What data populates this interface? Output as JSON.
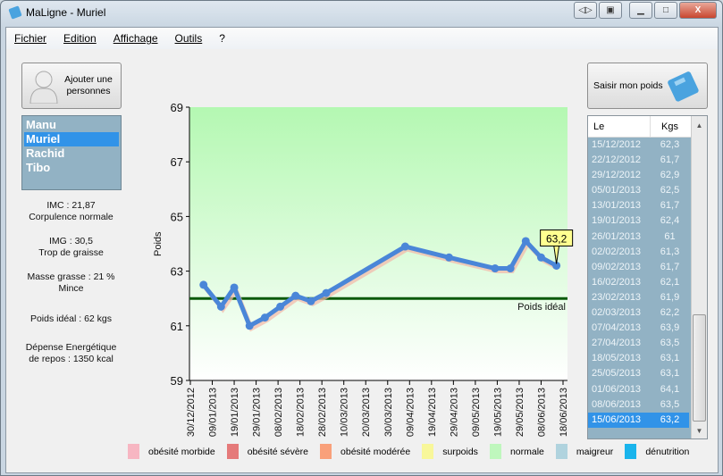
{
  "window": {
    "title": "MaLigne - Muriel",
    "close": "X"
  },
  "menu": [
    "Fichier",
    "Edition",
    "Affichage",
    "Outils",
    "?"
  ],
  "add_person_button": "Ajouter une personnes",
  "people": [
    {
      "name": "Manu",
      "selected": false
    },
    {
      "name": "Muriel",
      "selected": true
    },
    {
      "name": "Rachid",
      "selected": false
    },
    {
      "name": "Tibo",
      "selected": false
    }
  ],
  "stats": {
    "imc": "IMC : 21,87",
    "imc_label": "Corpulence normale",
    "img": "IMG : 30,5",
    "img_label": "Trop de graisse",
    "masse": "Masse grasse : 21 %",
    "masse_label": "Mince",
    "ideal": "Poids idéal : 62 kgs",
    "depense1": "Dépense Energétique",
    "depense2": "de repos : 1350 kcal"
  },
  "enter_weight_button": "Saisir mon poids",
  "table": {
    "headers": [
      "Le",
      "Kgs"
    ],
    "rows": [
      [
        "15/12/2012",
        "62,3"
      ],
      [
        "22/12/2012",
        "61,7"
      ],
      [
        "29/12/2012",
        "62,9"
      ],
      [
        "05/01/2013",
        "62,5"
      ],
      [
        "13/01/2013",
        "61,7"
      ],
      [
        "19/01/2013",
        "62,4"
      ],
      [
        "26/01/2013",
        "61"
      ],
      [
        "02/02/2013",
        "61,3"
      ],
      [
        "09/02/2013",
        "61,7"
      ],
      [
        "16/02/2013",
        "62,1"
      ],
      [
        "23/02/2013",
        "61,9"
      ],
      [
        "02/03/2013",
        "62,2"
      ],
      [
        "07/04/2013",
        "63,9"
      ],
      [
        "27/04/2013",
        "63,5"
      ],
      [
        "18/05/2013",
        "63,1"
      ],
      [
        "25/05/2013",
        "63,1"
      ],
      [
        "01/06/2013",
        "64,1"
      ],
      [
        "08/06/2013",
        "63,5"
      ],
      [
        "15/06/2013",
        "63,2"
      ]
    ],
    "selected": "15/06/2013"
  },
  "chart_data": {
    "type": "line",
    "ylabel": "Poids",
    "xlabel": "",
    "ylim": [
      59,
      69
    ],
    "yticks": [
      "59",
      "61",
      "63",
      "65",
      "67",
      "69"
    ],
    "xticks": [
      "30/12/2012",
      "09/01/2013",
      "19/01/2013",
      "29/01/2013",
      "08/02/2013",
      "18/02/2013",
      "28/02/2013",
      "10/03/2013",
      "20/03/2013",
      "30/03/2013",
      "09/04/2013",
      "19/04/2013",
      "29/04/2013",
      "09/05/2013",
      "19/05/2013",
      "29/05/2013",
      "08/06/2013",
      "18/06/2013"
    ],
    "xlim": [
      "30/12/2012",
      "18/06/2013"
    ],
    "series": [
      {
        "x": [
          "05/01/2013",
          "13/01/2013",
          "19/01/2013",
          "26/01/2013",
          "02/02/2013",
          "09/02/2013",
          "16/02/2013",
          "23/02/2013",
          "02/03/2013",
          "07/04/2013",
          "27/04/2013",
          "18/05/2013",
          "25/05/2013",
          "01/06/2013",
          "08/06/2013",
          "15/06/2013"
        ],
        "y": [
          62.5,
          61.7,
          62.4,
          61,
          61.3,
          61.7,
          62.1,
          61.9,
          62.2,
          63.9,
          63.5,
          63.1,
          63.1,
          64.1,
          63.5,
          63.2
        ],
        "color": "#4a86d8"
      }
    ],
    "reference_line": {
      "label": "Poids idéal",
      "value": 62,
      "color": "#0b5a0b"
    },
    "callout": "63,2",
    "background": "normal zone green gradient",
    "legend": [
      {
        "label": "obésité morbide",
        "color": "#f7b6c2"
      },
      {
        "label": "obésité sévère",
        "color": "#e57a7a"
      },
      {
        "label": "obésité modérée",
        "color": "#f9a07a"
      },
      {
        "label": "surpoids",
        "color": "#f8f79a"
      },
      {
        "label": "normale",
        "color": "#bff7bd"
      },
      {
        "label": "maigreur",
        "color": "#b0d3de"
      },
      {
        "label": "dénutrition",
        "color": "#19b4ec"
      }
    ]
  }
}
